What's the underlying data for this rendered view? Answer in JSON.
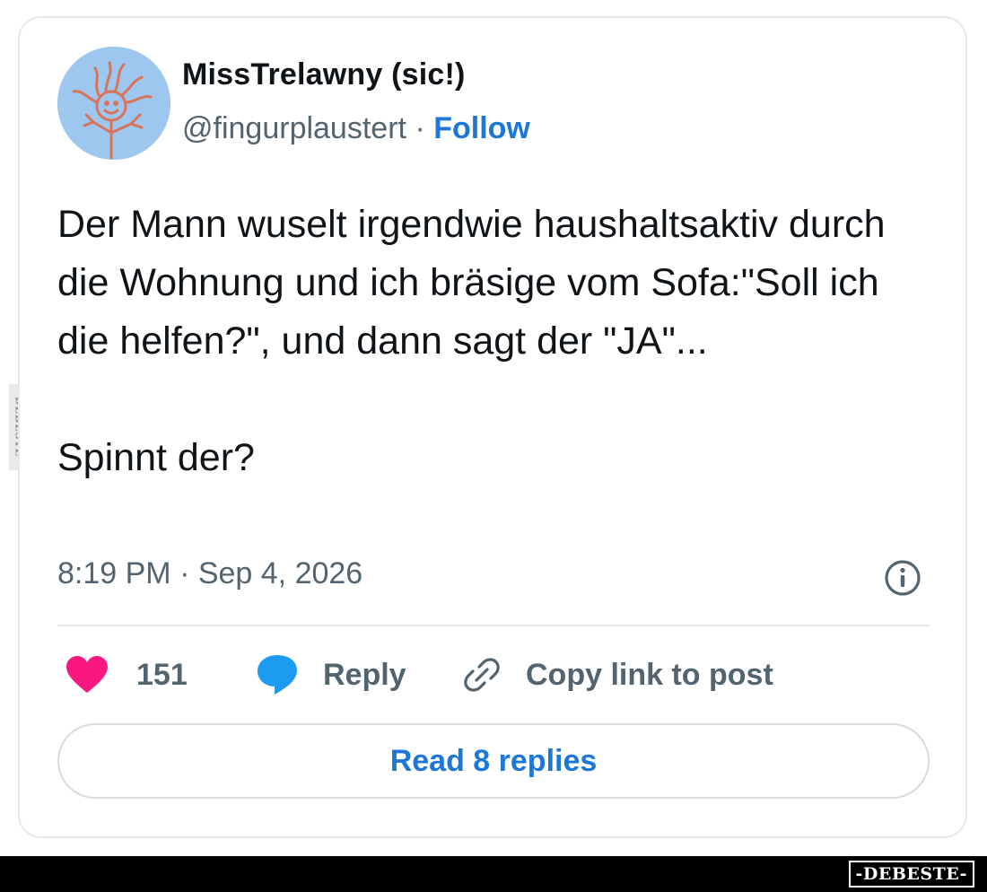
{
  "profile": {
    "name": "MissTrelawny (sic!)",
    "handle": "@fingurplaustert",
    "separator": "·",
    "follow_label": "Follow",
    "avatar_color": "#9ec7ef"
  },
  "tweet": {
    "lines": [
      "Der Mann wuselt irgendwie haushaltsaktiv durch die Wohnung und ich bräsige vom Sofa:\"Soll ich die helfen?\", und dann sagt der \"JA\"...",
      "Spinnt der?"
    ],
    "timestamp": "8:19 PM · Sep 4, 2026"
  },
  "actions": {
    "like_count": "151",
    "reply_label": "Reply",
    "copy_link_label": "Copy link to post",
    "read_replies_label": "Read 8 replies"
  },
  "icons": {
    "heart": "heart-icon",
    "reply": "speech-bubble-icon",
    "link": "link-icon",
    "info": "info-icon"
  },
  "colors": {
    "link_blue": "#1d77d4",
    "heart_pink": "#f91880",
    "reply_blue": "#1d9bf0",
    "muted": "#536471"
  },
  "watermark": {
    "side_text": "DEBESTE",
    "brand": "-DEBESTE-"
  }
}
